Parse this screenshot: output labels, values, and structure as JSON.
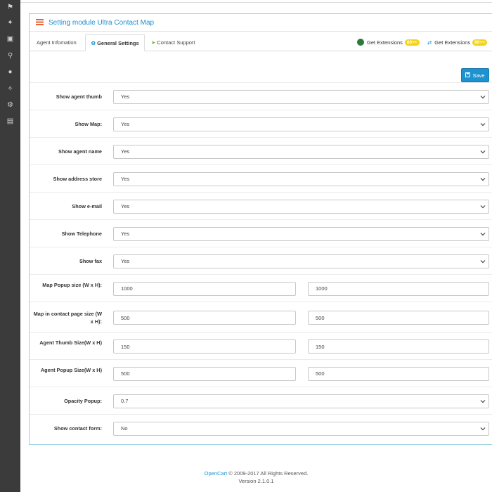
{
  "sidebar": {
    "icons": [
      "tags-icon",
      "puzzle-icon",
      "desktop-icon",
      "cart-icon",
      "user-icon",
      "share-icon",
      "cog-icon",
      "bar-chart-icon"
    ]
  },
  "panel": {
    "title": "Setting module Ultra Contact Map"
  },
  "tabs": [
    {
      "label": "Agent Infomation",
      "icon": "none"
    },
    {
      "label": "General Settings",
      "icon": "gear-icon",
      "active": true
    },
    {
      "label": "Contact Support",
      "icon": "paper-plane-icon"
    }
  ],
  "extensions": [
    {
      "label": "Get Extensions",
      "badge": "80++"
    },
    {
      "label": "Get Extensions",
      "badge": "80++"
    }
  ],
  "save_label": "Save",
  "rows": [
    {
      "label": "Show agent thumb",
      "type": "select",
      "value": "Yes"
    },
    {
      "label": "Show Map:",
      "type": "select",
      "value": "Yes"
    },
    {
      "label": "Show agent name",
      "type": "select",
      "value": "Yes"
    },
    {
      "label": "Show address store",
      "type": "select",
      "value": "Yes"
    },
    {
      "label": "Show e-mail",
      "type": "select",
      "value": "Yes"
    },
    {
      "label": "Show Telephone",
      "type": "select",
      "value": "Yes"
    },
    {
      "label": "Show fax",
      "type": "select",
      "value": "Yes"
    },
    {
      "label": "Map Popup size (W x H):",
      "type": "pair",
      "w": "1000",
      "h": "1000"
    },
    {
      "label": "Map in contact page size (W x H):",
      "type": "pair",
      "w": "500",
      "h": "500"
    },
    {
      "label": "Agent Thumb Size(W x H)",
      "type": "pair",
      "w": "150",
      "h": "150"
    },
    {
      "label": "Agent Popup Size(W x H)",
      "type": "pair",
      "w": "500",
      "h": "500"
    },
    {
      "label": "Opacity Popup:",
      "type": "select",
      "value": "0.7"
    },
    {
      "label": "Show contact form:",
      "type": "select",
      "value": "No"
    }
  ],
  "footer": {
    "brand": "OpenCart",
    "copyright": " © 2009-2017 All Rights Reserved.",
    "version": "Version 2.1.0.1"
  },
  "colors": {
    "accent": "#1e91cf",
    "sidebar": "#3b3b3b",
    "badge": "#f4d31c"
  }
}
